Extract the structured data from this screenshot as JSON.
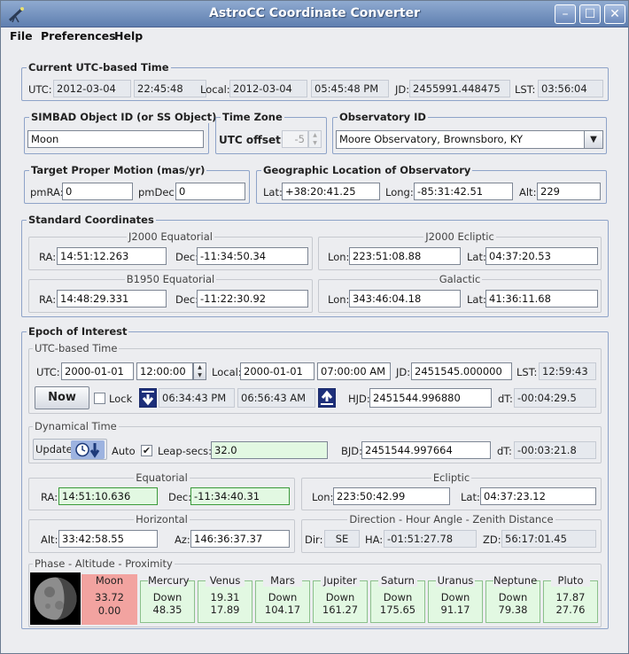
{
  "window": {
    "title": "AstroCC Coordinate Converter"
  },
  "menu": [
    "File",
    "Preferences",
    "Help"
  ],
  "current_time": {
    "legend": "Current UTC-based Time",
    "utc_label": "UTC:",
    "utc_date": "2012-03-04",
    "utc_time": "22:45:48",
    "local_label": "Local:",
    "local_date": "2012-03-04",
    "local_time": "05:45:48 PM",
    "jd_label": "JD:",
    "jd": "2455991.448475",
    "lst_label": "LST:",
    "lst": "03:56:04"
  },
  "simbad": {
    "legend": "SIMBAD Object ID (or SS Object)",
    "value": "Moon"
  },
  "timezone": {
    "legend": "Time Zone",
    "label": "UTC offset:",
    "value": "-5"
  },
  "observatory": {
    "legend": "Observatory ID",
    "value": "Moore Observatory, Brownsboro, KY"
  },
  "proper_motion": {
    "legend": "Target Proper Motion (mas/yr)",
    "pmra_label": "pmRA:",
    "pmra": "0",
    "pmdec_label": "pmDec:",
    "pmdec": "0"
  },
  "geo": {
    "legend": "Geographic Location of Observatory",
    "lat_label": "Lat:",
    "lat": "+38:20:41.25",
    "long_label": "Long:",
    "long": "-85:31:42.51",
    "alt_label": "Alt:",
    "alt": "229"
  },
  "standard": {
    "legend": "Standard Coordinates",
    "j2000eq": {
      "title": "J2000 Equatorial",
      "ra_label": "RA:",
      "ra": "14:51:12.263",
      "dec_label": "Dec:",
      "dec": "-11:34:50.34"
    },
    "j2000ecl": {
      "title": "J2000 Ecliptic",
      "lon_label": "Lon:",
      "lon": "223:51:08.88",
      "lat_label": "Lat:",
      "lat": "04:37:20.53"
    },
    "b1950eq": {
      "title": "B1950 Equatorial",
      "ra_label": "RA:",
      "ra": "14:48:29.331",
      "dec_label": "Dec:",
      "dec": "-11:22:30.92"
    },
    "galactic": {
      "title": "Galactic",
      "lon_label": "Lon:",
      "lon": "343:46:04.18",
      "lat_label": "Lat:",
      "lat": "41:36:11.68"
    }
  },
  "epoch": {
    "legend": "Epoch of Interest",
    "utc": {
      "title": "UTC-based Time",
      "utc_label": "UTC:",
      "utc_date": "2000-01-01",
      "utc_time": "12:00:00",
      "local_label": "Local:",
      "local_date": "2000-01-01",
      "local_time": "07:00:00 AM",
      "jd_label": "JD:",
      "jd": "2451545.000000",
      "lst_label": "LST:",
      "lst": "12:59:43",
      "now": "Now",
      "lock": "Lock",
      "set_time": "06:34:43 PM",
      "rise_time": "06:56:43 AM",
      "hjd_label": "HJD:",
      "hjd": "2451544.996880",
      "dt_label": "dT:",
      "dt": "-00:04:29.5"
    },
    "dyn": {
      "title": "Dynamical Time",
      "update": "Update",
      "auto": "Auto",
      "leap_label": "Leap-secs:",
      "leap": "32.0",
      "bjd_label": "BJD:",
      "bjd": "2451544.997664",
      "dt_label": "dT:",
      "dt": "-00:03:21.8"
    },
    "equatorial": {
      "title": "Equatorial",
      "ra_label": "RA:",
      "ra": "14:51:10.636",
      "dec_label": "Dec:",
      "dec": "-11:34:40.31"
    },
    "ecliptic": {
      "title": "Ecliptic",
      "lon_label": "Lon:",
      "lon": "223:50:42.99",
      "lat_label": "Lat:",
      "lat": "04:37:23.12"
    },
    "horizontal": {
      "title": "Horizontal",
      "alt_label": "Alt:",
      "alt": "33:42:58.55",
      "az_label": "Az:",
      "az": "146:36:37.37"
    },
    "direction": {
      "title": "Direction - Hour Angle - Zenith Distance",
      "dir_label": "Dir:",
      "dir": "SE",
      "ha_label": "HA:",
      "ha": "-01:51:27.78",
      "zd_label": "ZD:",
      "zd": "56:17:01.45"
    },
    "phase": {
      "title": "Phase - Altitude - Proximity",
      "moon": {
        "name": "Moon",
        "v1": "33.72",
        "v2": "0.00"
      },
      "planets": [
        {
          "name": "Mercury",
          "v1": "Down",
          "v2": "48.35"
        },
        {
          "name": "Venus",
          "v1": "19.31",
          "v2": "17.89"
        },
        {
          "name": "Mars",
          "v1": "Down",
          "v2": "104.17"
        },
        {
          "name": "Jupiter",
          "v1": "Down",
          "v2": "161.27"
        },
        {
          "name": "Saturn",
          "v1": "Down",
          "v2": "175.65"
        },
        {
          "name": "Uranus",
          "v1": "Down",
          "v2": "91.17"
        },
        {
          "name": "Neptune",
          "v1": "Down",
          "v2": "79.38"
        },
        {
          "name": "Pluto",
          "v1": "17.87",
          "v2": "27.76"
        }
      ]
    }
  },
  "colors": {
    "moon_panel": "#f2a3a0",
    "planet_panel": "#e2f8e2",
    "group_border": "#8ea3c8"
  }
}
